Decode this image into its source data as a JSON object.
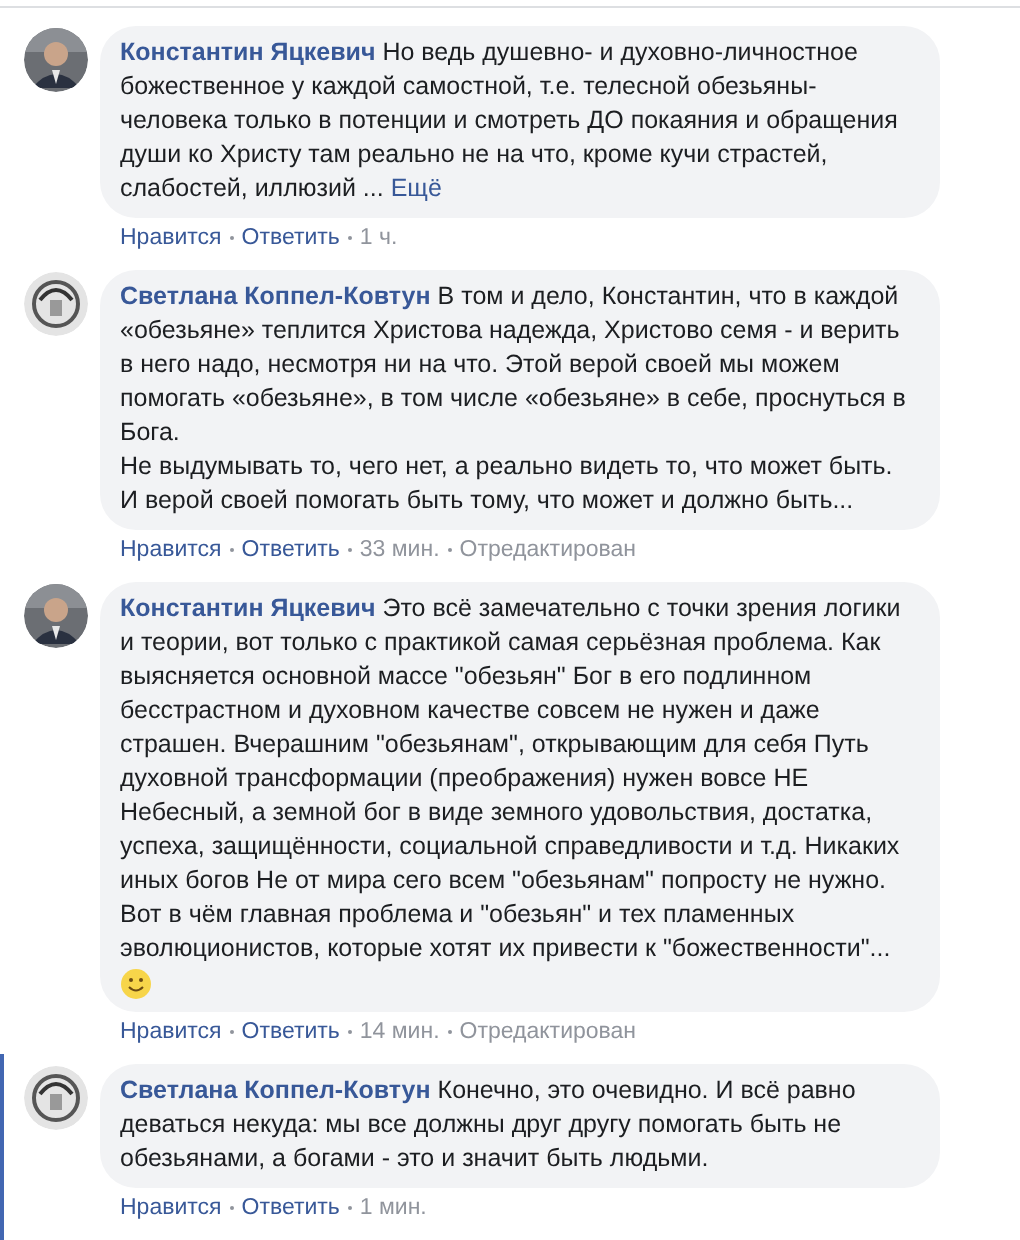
{
  "comments": [
    {
      "author": "Константин Яцкевич",
      "kind": "suit",
      "text": "Но ведь душевно- и духовно-личностное божественное у каждой самостной, т.е. телесной обезьяны-человека только в потенции и смотреть ДО покаяния и обращения души ко Христу там реально не на что, кроме кучи страстей, слабостей, иллюзий ...",
      "more_link": "Ещё",
      "smiley": false,
      "highlighted": false,
      "actions": [
        "Нравится",
        "Ответить"
      ],
      "time": "1 ч."
    },
    {
      "author": "Светлана Коппел-Ковтун",
      "kind": "sketch",
      "text": "В том и дело, Константин, что в каждой «обезьяне» теплится Христова надежда, Христово семя - и верить в него надо, несмотря ни на что. Этой верой своей мы можем помогать «обезьяне», в том числе «обезьяне» в себе, проснуться в Бога.\nНе выдумывать то, чего нет, а реально видеть то, что может быть. И верой своей помогать быть тому, что может и должно быть...",
      "smiley": false,
      "highlighted": false,
      "actions": [
        "Нравится",
        "Ответить"
      ],
      "time": "33 мин.",
      "edited": "Отредактирован"
    },
    {
      "author": "Константин Яцкевич",
      "kind": "suit",
      "text": "Это всё замечательно с точки зрения логики и теории, вот только с практикой самая серьёзная проблема. Как выясняется основной массе \"обезьян\" Бог в его подлинном бесстрастном и духовном качестве совсем не нужен и даже страшен. Вчерашним \"обезьянам\", открывающим для себя Путь духовной трансформации (преображения) нужен вовсе НЕ Небесный, а земной бог в виде земного удовольствия, достатка, успеха, защищённости, социальной справедливости и т.д. Никаких иных богов Не от мира сего всем \"обезьянам\" попросту не нужно. Вот в чём главная проблема и \"обезьян\" и тех пламенных эволюционистов, которые хотят их привести к \"божественности\"...",
      "smiley": true,
      "highlighted": false,
      "actions": [
        "Нравится",
        "Ответить"
      ],
      "time": "14 мин.",
      "edited": "Отредактирован"
    },
    {
      "author": "Светлана Коппел-Ковтун",
      "kind": "sketch",
      "text": "Конечно, это очевидно. И всё равно деваться некуда: мы все должны друг другу помогать быть не обезьянами, а богами - это и значит быть людьми.",
      "smiley": false,
      "highlighted": true,
      "actions": [
        "Нравится",
        "Ответить"
      ],
      "time": "1 мин."
    }
  ]
}
